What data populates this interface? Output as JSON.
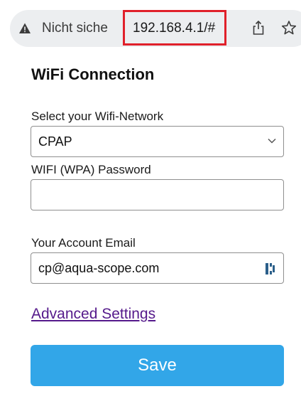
{
  "browser": {
    "security_label": "Nicht siche",
    "url": "192.168.4.1/#",
    "highlight_color": "#e0202a",
    "icons": [
      "warning-triangle-icon",
      "share-icon",
      "star-icon"
    ]
  },
  "form": {
    "title": "WiFi Connection",
    "network_label": "Select your Wifi-Network",
    "network_value": "CPAP",
    "password_label": "WIFI (WPA) Password",
    "password_value": "",
    "email_label": "Your Account Email",
    "email_value": "cp@aqua-scope.com",
    "advanced_link": "Advanced Settings",
    "save_label": "Save"
  },
  "colors": {
    "accent": "#32a6e8",
    "link": "#551a8b"
  }
}
